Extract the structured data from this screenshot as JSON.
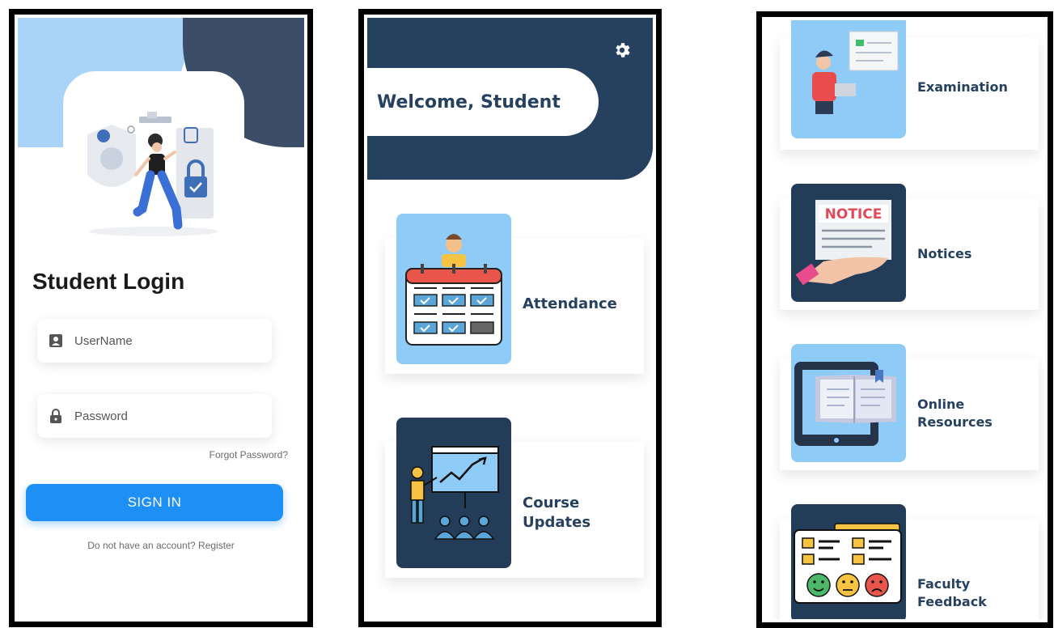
{
  "login": {
    "title": "Student Login",
    "username_placeholder": "UserName",
    "password_placeholder": "Password",
    "forgot_password": "Forgot Password?",
    "sign_in": "SIGN IN",
    "register_prompt": "Do not have an account? Register"
  },
  "dashboard": {
    "welcome": "Welcome, Student",
    "cards": [
      {
        "label_line1": "Attendance",
        "label_line2": "",
        "icon": "attendance-calendar-icon"
      },
      {
        "label_line1": "Course",
        "label_line2": "Updates",
        "icon": "presentation-board-icon"
      }
    ]
  },
  "menu": {
    "cards": [
      {
        "label_line1": "Examination",
        "label_line2": "",
        "icon": "exam-person-laptop-icon"
      },
      {
        "label_line1": "Notices",
        "label_line2": "",
        "icon": "notice-paper-icon",
        "notice_text": "NOTICE"
      },
      {
        "label_line1": "Online",
        "label_line2": "Resources",
        "icon": "tablet-book-icon"
      },
      {
        "label_line1": "Faculty",
        "label_line2": "Feedback",
        "icon": "feedback-form-icon"
      }
    ]
  },
  "colors": {
    "navy": "#26415f",
    "light_blue": "#a9d4f7",
    "button_blue": "#1e90f5",
    "thumb_light": "#8ecbf7",
    "thumb_dark": "#233c58"
  }
}
